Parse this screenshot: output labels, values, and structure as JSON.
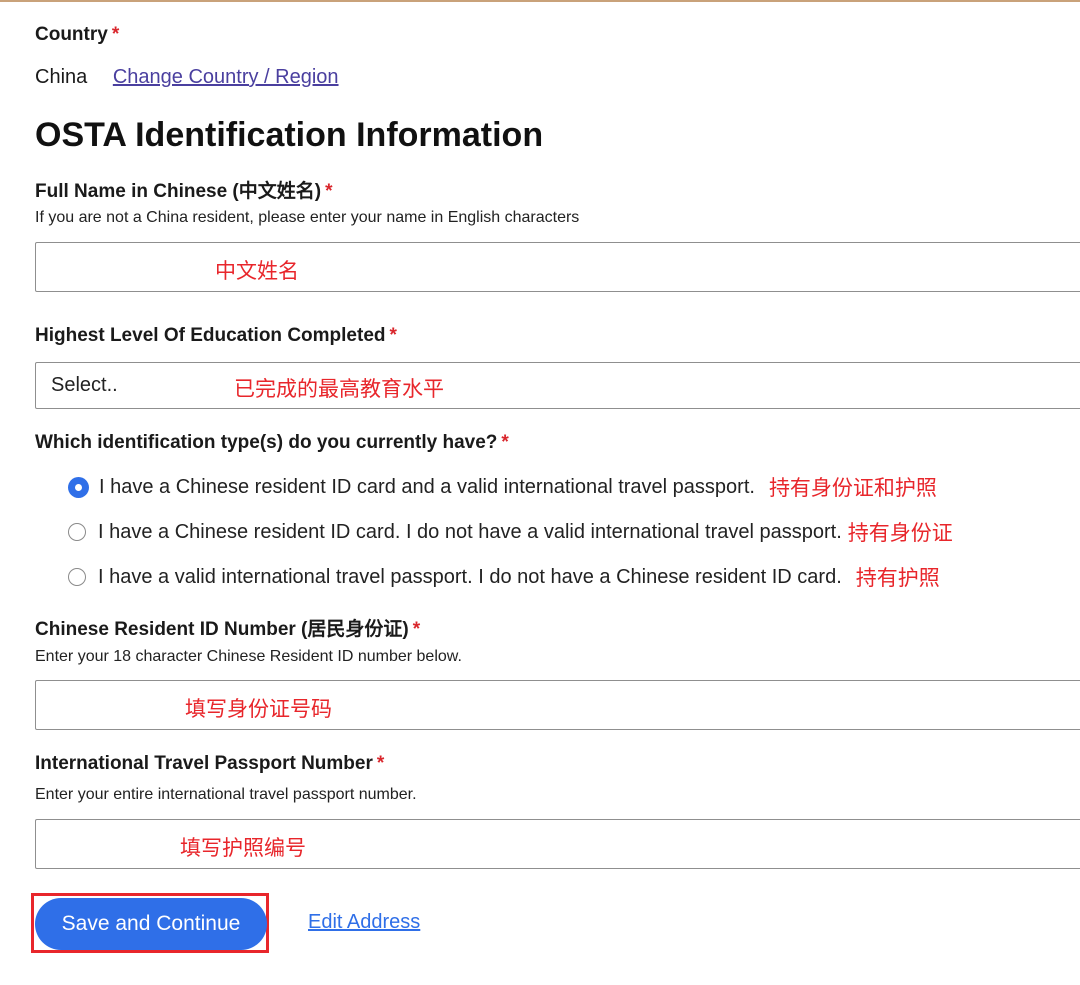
{
  "country": {
    "label": "Country",
    "required_mark": "*",
    "value": "China",
    "change_link": "Change Country / Region"
  },
  "section_title": "OSTA Identification Information",
  "full_name": {
    "label": "Full Name in Chinese (中文姓名)",
    "required_mark": "*",
    "help": "If you are not a China resident, please enter your name in English characters",
    "annotation": "中文姓名"
  },
  "education": {
    "label": "Highest Level Of Education Completed",
    "required_mark": "*",
    "selected": "Select..",
    "annotation": "已完成的最高教育水平"
  },
  "id_type": {
    "label": "Which identification type(s) do you currently have?",
    "required_mark": "*",
    "options": [
      {
        "text": "I have a Chinese resident ID card and a valid international travel passport.",
        "annotation": "持有身份证和护照",
        "checked": true
      },
      {
        "text": "I have a Chinese resident ID card. I do not have a valid international travel passport.",
        "annotation": "持有身份证",
        "checked": false
      },
      {
        "text": "I have a valid international travel passport. I do not have a Chinese resident ID card.",
        "annotation": "持有护照",
        "checked": false
      }
    ]
  },
  "resident_id": {
    "label": "Chinese Resident ID Number (居民身份证)",
    "required_mark": "*",
    "help": "Enter your 18 character Chinese Resident ID number below.",
    "annotation": "填写身份证号码"
  },
  "passport": {
    "label": "International Travel Passport Number",
    "required_mark": "*",
    "help": "Enter your entire international travel passport number.",
    "annotation": "填写护照编号"
  },
  "actions": {
    "save_label": "Save and Continue",
    "edit_address_label": "Edit Address"
  },
  "colors": {
    "primary": "#2f6fe8",
    "annotation_red": "#e8262b",
    "link": "#4a3f9f"
  }
}
